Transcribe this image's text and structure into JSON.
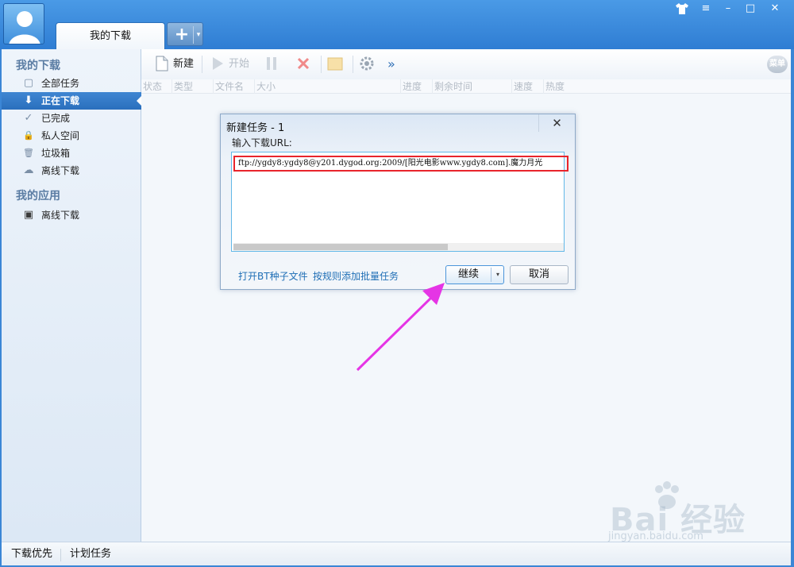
{
  "app": {
    "tab_title": "我的下载"
  },
  "window_controls": {
    "skin_icon": "shirt-icon",
    "menu_icon": "dropdown-menu-icon",
    "minimize": "–",
    "maximize": "□",
    "close": "✕"
  },
  "tab_add": {
    "plus": "+",
    "arrow": "▾"
  },
  "sidebar": {
    "section1": "我的下载",
    "items": [
      {
        "label": "全部任务",
        "icon": "document-icon",
        "glyph": "▢"
      },
      {
        "label": "正在下载",
        "icon": "download-arrow-icon",
        "glyph": "⬇",
        "active": true
      },
      {
        "label": "已完成",
        "icon": "check-icon",
        "glyph": "✓"
      },
      {
        "label": "私人空间",
        "icon": "lock-icon",
        "glyph": "🔒"
      },
      {
        "label": "垃圾箱",
        "icon": "trash-icon",
        "glyph": "🗑"
      },
      {
        "label": "离线下载",
        "icon": "cloud-download-icon",
        "glyph": "☁"
      }
    ],
    "section2": "我的应用",
    "apps": [
      {
        "label": "离线下载",
        "icon": "offline-download-app-icon",
        "glyph": "▣"
      }
    ]
  },
  "toolbar": {
    "new_label": "新建",
    "start_label": "开始",
    "more": "»",
    "menu_label": "菜单"
  },
  "columns": [
    "状态",
    "类型",
    "文件名",
    "大小",
    "进度",
    "剩余时间",
    "速度",
    "热度"
  ],
  "dialog": {
    "title": "新建任务 - 1",
    "close": "✕",
    "label": "输入下载URL:",
    "url": "ftp://ygdy8:ygdy8@y201.dygod.org:2009/[阳光电影www.ygdy8.com].魔力月光",
    "link_bt": "打开BT种子文件",
    "link_batch": "按规则添加批量任务",
    "continue": "继续",
    "continue_arrow": "▾",
    "cancel": "取消"
  },
  "statusbar": {
    "priority": "下载优先",
    "scheduled": "计划任务"
  },
  "watermark": {
    "text": "Bai 经验",
    "sub": "jingyan.baidu.com"
  },
  "colors": {
    "accent": "#2f7dd3",
    "highlight_box": "#e8242b",
    "annotation_arrow": "#e535e5"
  }
}
